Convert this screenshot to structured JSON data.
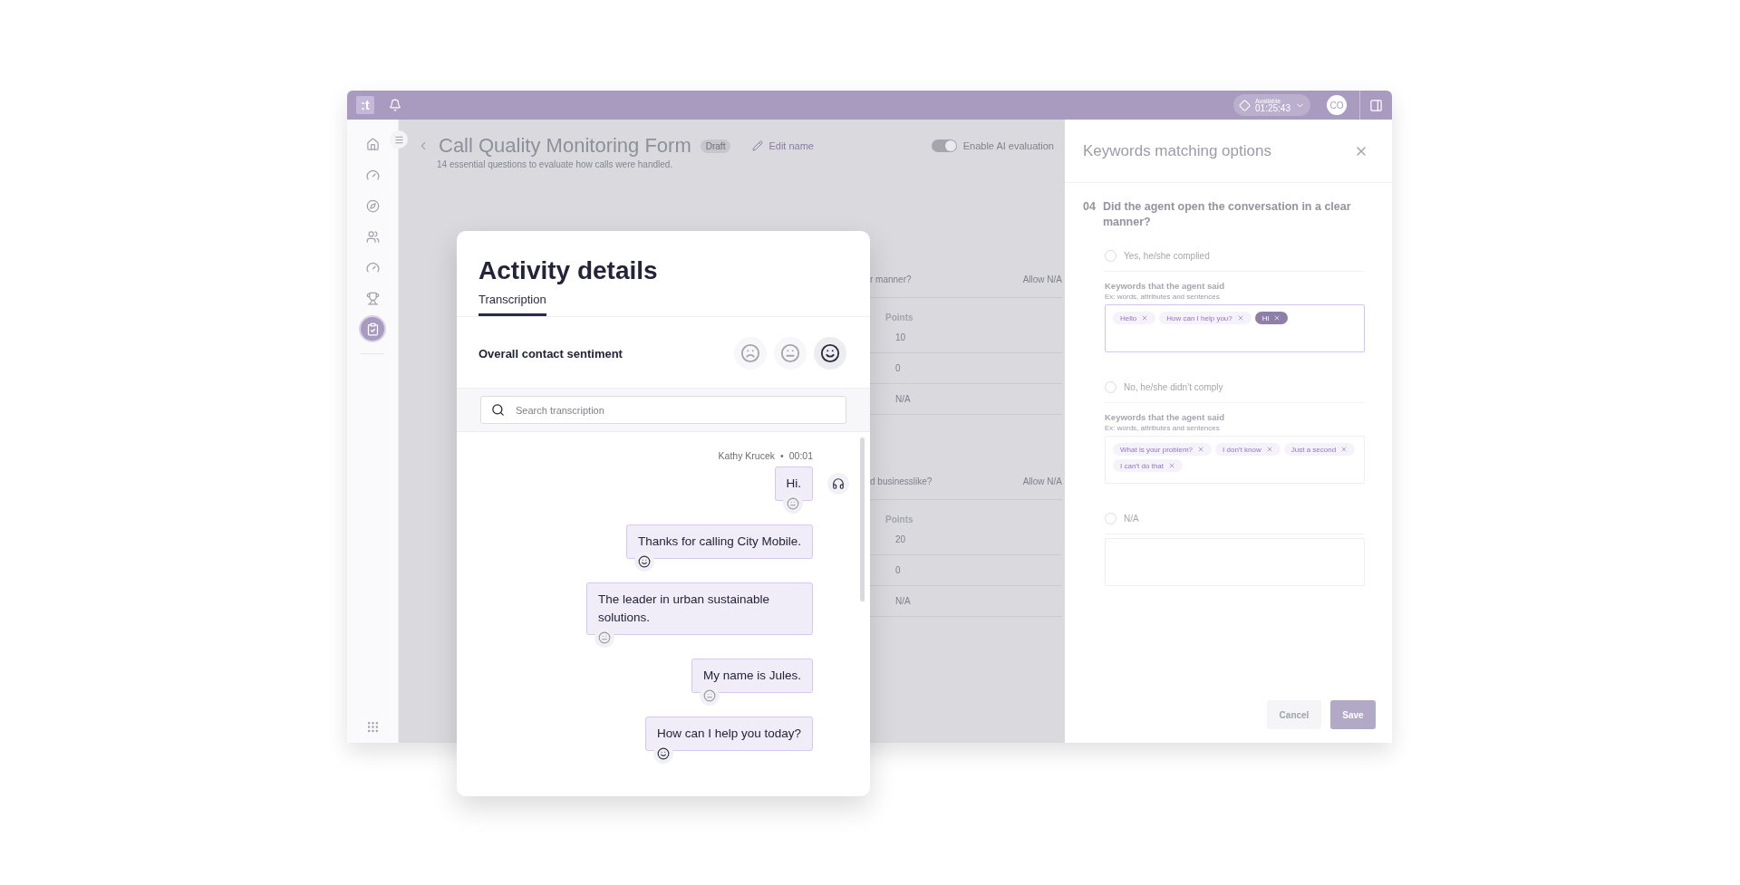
{
  "topbar": {
    "logo": ":t",
    "status": {
      "label": "Available",
      "time": "01:25:43"
    },
    "avatar": "CO"
  },
  "nav": {
    "items": [
      {
        "kind": "home",
        "selected": false
      },
      {
        "kind": "gauge",
        "selected": false
      },
      {
        "kind": "compass",
        "selected": false
      },
      {
        "kind": "people",
        "selected": false
      },
      {
        "kind": "gauge",
        "selected": false
      },
      {
        "kind": "trophy",
        "selected": false
      },
      {
        "kind": "clipboard",
        "selected": true
      }
    ]
  },
  "form": {
    "title": "Call Quality Monitoring Form",
    "badge": "Draft",
    "edit_label": "Edit name",
    "ai_toggle": {
      "label": "Enable AI evaluation",
      "on": true
    },
    "subtitle": "14 essential questions to evaluate how calls were handled.",
    "questions": [
      {
        "text": "r manner?",
        "allow_na": "Allow N/A",
        "points_label": "Points",
        "points": [
          "10",
          "0",
          "N/A"
        ]
      },
      {
        "text": "d businesslike?",
        "allow_na": "Allow N/A",
        "points_label": "Points",
        "points": [
          "20",
          "0",
          "N/A"
        ]
      }
    ]
  },
  "activity": {
    "title": "Activity details",
    "tabs": [
      {
        "label": "Transcription",
        "selected": true
      }
    ],
    "sentiment_label": "Overall contact sentiment",
    "sentiment_options": [
      {
        "kind": "negative",
        "selected": false
      },
      {
        "kind": "neutral",
        "selected": false
      },
      {
        "kind": "positive",
        "selected": true
      }
    ],
    "search": {
      "placeholder": "Search transcription"
    },
    "speaker": "Kathy Krucek",
    "separator": "•",
    "time": "00:01",
    "messages": [
      {
        "text": "Hi.",
        "kind": "neutral"
      },
      {
        "text": "Thanks for calling City Mobile.",
        "kind": "positive"
      },
      {
        "text": "The leader in urban sustainable solutions.",
        "kind": "neutral"
      },
      {
        "text": "My name is Jules.",
        "kind": "neutral"
      },
      {
        "text": "How can I help you today?",
        "kind": "positive"
      }
    ]
  },
  "keywords_panel": {
    "title": "Keywords matching options",
    "number": "04",
    "question": "Did the agent open the conversation in a clear manner?",
    "options": [
      {
        "label": "Yes, he/she complied",
        "selected": false,
        "keywords_label": "Keywords that the agent said",
        "keywords_hint": "Ex: words, attributes and sentences",
        "focused": true,
        "keywords": [
          {
            "text": "Hello",
            "selected": false
          },
          {
            "text": "How can I help you?",
            "selected": false
          },
          {
            "text": "Hi",
            "selected": true
          }
        ]
      },
      {
        "label": "No, he/she didn’t comply",
        "selected": false,
        "keywords_label": "Keywords that the agent said",
        "keywords_hint": "Ex: words, attributes and sentences",
        "focused": false,
        "keywords": [
          {
            "text": "What is your problem?",
            "selected": false
          },
          {
            "text": "I don’t know",
            "selected": false
          },
          {
            "text": "Just a second",
            "selected": false
          },
          {
            "text": "I can’t do that",
            "selected": false
          }
        ]
      },
      {
        "label": "N/A",
        "selected": false,
        "focused": false
      }
    ],
    "cancel": "Cancel",
    "save": "Save"
  }
}
